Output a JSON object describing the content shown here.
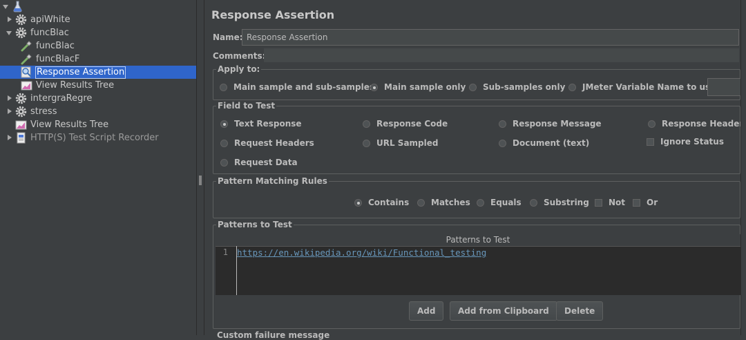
{
  "tree": {
    "items": [
      {
        "label": "apiWhite"
      },
      {
        "label": "funcBlac"
      },
      {
        "label": "funcBlac"
      },
      {
        "label": "funcBlacF"
      },
      {
        "label": "Response Assertion"
      },
      {
        "label": "View Results Tree"
      },
      {
        "label": "intergraRegre"
      },
      {
        "label": "stress"
      },
      {
        "label": "View Results Tree"
      },
      {
        "label": "HTTP(S) Test Script Recorder"
      }
    ]
  },
  "panel": {
    "title": "Response Assertion",
    "name_label": "Name:",
    "name_value": "Response Assertion",
    "comments_label": "Comments:",
    "apply_to": {
      "legend": "Apply to:",
      "options": [
        "Main sample and sub-samples",
        "Main sample only",
        "Sub-samples only",
        "JMeter Variable Name to use"
      ],
      "selected": "Main sample only"
    },
    "field_to_test": {
      "legend": "Field to Test",
      "options": [
        "Text Response",
        "Response Code",
        "Response Message",
        "Response Headers",
        "Request Headers",
        "URL Sampled",
        "Document (text)",
        "Request Data"
      ],
      "checkbox": "Ignore Status",
      "selected": "Text Response"
    },
    "pattern_rules": {
      "legend": "Pattern Matching Rules",
      "options": [
        "Contains",
        "Matches",
        "Equals",
        "Substring"
      ],
      "checks": [
        "Not",
        "Or"
      ],
      "selected": "Contains"
    },
    "patterns": {
      "legend": "Patterns to Test",
      "column_header": "Patterns to Test",
      "line_number": "1",
      "value": "https://en.wikipedia.org/wiki/Functional_testing"
    },
    "buttons": {
      "add": "Add",
      "add_clipboard": "Add from Clipboard",
      "delete": "Delete"
    },
    "custom_failure_label": "Custom failure message"
  }
}
